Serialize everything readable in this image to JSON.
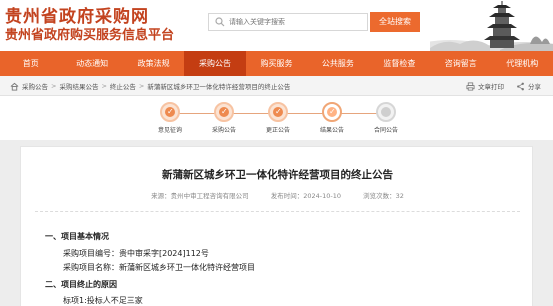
{
  "header": {
    "title": "贵州省政府采购网",
    "subtitle": "贵州省政府购买服务信息平台",
    "search": {
      "placeholder": "请输入关键字搜索",
      "button_label": "全站搜索"
    }
  },
  "nav": {
    "items": [
      {
        "label": "首页",
        "active": false
      },
      {
        "label": "动态通知",
        "active": false
      },
      {
        "label": "政策法规",
        "active": false
      },
      {
        "label": "采购公告",
        "active": true
      },
      {
        "label": "购买服务",
        "active": false
      },
      {
        "label": "公共服务",
        "active": false
      },
      {
        "label": "监督检查",
        "active": false
      },
      {
        "label": "咨询留言",
        "active": false
      },
      {
        "label": "代理机构",
        "active": false
      }
    ]
  },
  "breadcrumb": {
    "items": [
      "采购公告",
      "采购结果公告",
      "终止公告",
      "新蒲新区城乡环卫一体化特许经营项目的终止公告"
    ],
    "print_label": "文章打印",
    "share_label": "分享"
  },
  "steps": {
    "items": [
      {
        "label": "意见征询",
        "state": "done"
      },
      {
        "label": "采购公告",
        "state": "done"
      },
      {
        "label": "更正公告",
        "state": "done"
      },
      {
        "label": "结果公告",
        "state": "current"
      },
      {
        "label": "合同公告",
        "state": "pending"
      }
    ]
  },
  "article": {
    "title": "新蒲新区城乡环卫一体化特许经营项目的终止公告",
    "meta": {
      "source": "来源：贵州中审工程咨询有限公司",
      "date": "发布时间：2024-10-10",
      "views": "浏览次数：32"
    },
    "sections": {
      "s1_title": "一、项目基本情况",
      "s1_line1": "采购项目编号：贵中审采字[2024]112号",
      "s1_line2": "采购项目名称：新蒲新区城乡环卫一体化特许经营项目",
      "s2_title": "二、项目终止的原因",
      "s2_line1": "标项1:投标人不足三家"
    }
  },
  "colors": {
    "brand": "#c3431f",
    "nav": "#e9642a",
    "nav_active": "#c43d12",
    "accent": "#ec6a2e"
  }
}
